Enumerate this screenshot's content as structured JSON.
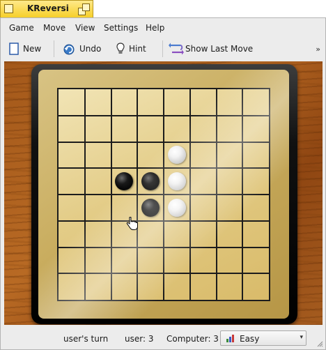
{
  "window": {
    "title": "KReversi"
  },
  "menubar": {
    "items": [
      "Game",
      "Move",
      "View",
      "Settings",
      "Help"
    ]
  },
  "toolbar": {
    "new_label": "New",
    "undo_label": "Undo",
    "hint_label": "Hint",
    "show_last_move_label": "Show Last Move",
    "overflow_icon": "chevron-double-right-icon"
  },
  "board": {
    "size": 8,
    "stones": [
      {
        "row": 2,
        "col": 4,
        "color": "white"
      },
      {
        "row": 3,
        "col": 2,
        "color": "black"
      },
      {
        "row": 3,
        "col": 3,
        "color": "black"
      },
      {
        "row": 3,
        "col": 4,
        "color": "white"
      },
      {
        "row": 4,
        "col": 3,
        "color": "black"
      },
      {
        "row": 4,
        "col": 4,
        "color": "white"
      }
    ]
  },
  "status": {
    "turn": "user's turn",
    "user_score": "user: 3",
    "computer_score": "Computer: 3",
    "difficulty": "Easy"
  },
  "colors": {
    "title_tab": "#f6cf2a",
    "wood": "#a3581a",
    "board_gold": "#c9ad5f"
  }
}
